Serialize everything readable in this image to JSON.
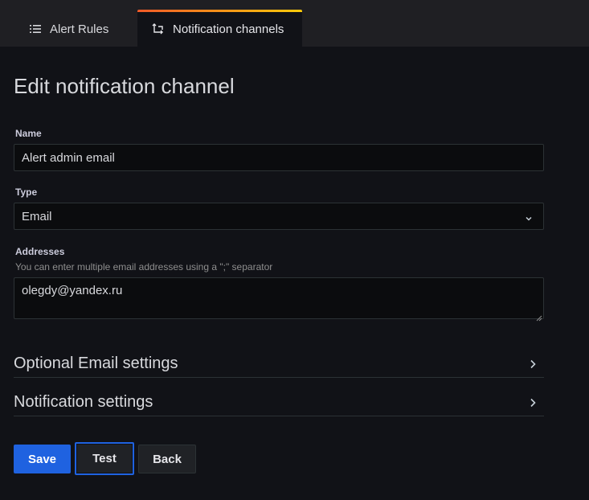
{
  "tabs": {
    "alert_rules": {
      "label": "Alert Rules",
      "icon": "list-icon"
    },
    "notification_channels": {
      "label": "Notification channels",
      "icon": "comment-alt-share-icon"
    }
  },
  "page": {
    "title": "Edit notification channel"
  },
  "form": {
    "name": {
      "label": "Name",
      "value": "Alert admin email"
    },
    "type": {
      "label": "Type",
      "value": "Email"
    },
    "addresses": {
      "label": "Addresses",
      "description": "You can enter multiple email addresses using a \";\" separator",
      "value": "olegdy@yandex.ru"
    }
  },
  "sections": {
    "optional_email": "Optional Email settings",
    "notification": "Notification settings"
  },
  "buttons": {
    "save": "Save",
    "test": "Test",
    "back": "Back"
  },
  "colors": {
    "primary": "#1f62e0",
    "tab_accent_start": "#f05a28",
    "tab_accent_end": "#fbca0a",
    "background": "#111217"
  }
}
